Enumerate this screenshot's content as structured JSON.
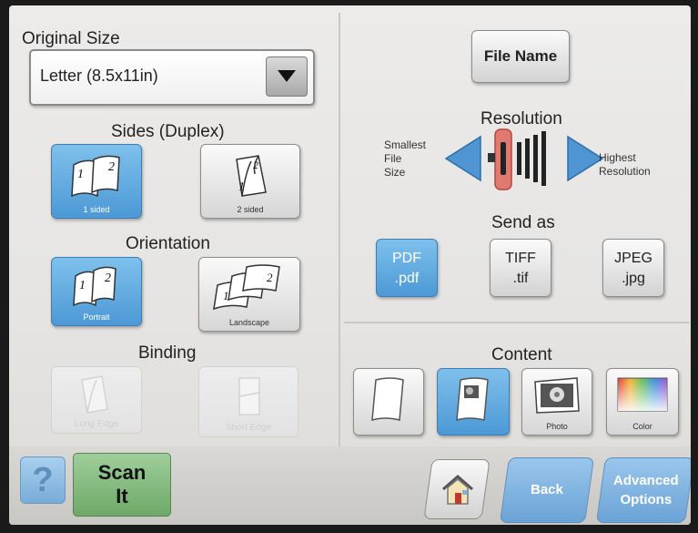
{
  "original_size": {
    "title": "Original Size",
    "selected": "Letter (8.5x11in)"
  },
  "sides": {
    "title": "Sides (Duplex)",
    "options": [
      {
        "label": "1 sided",
        "selected": true
      },
      {
        "label": "2 sided",
        "selected": false
      }
    ]
  },
  "orientation": {
    "title": "Orientation",
    "options": [
      {
        "label": "Portrait",
        "selected": true
      },
      {
        "label": "Landscape",
        "selected": false
      }
    ]
  },
  "binding": {
    "title": "Binding",
    "options": [
      {
        "label": "Long Edge",
        "enabled": false
      },
      {
        "label": "Short Edge",
        "enabled": false
      }
    ]
  },
  "file_name_button": "File Name",
  "resolution": {
    "title": "Resolution",
    "left_label": [
      "Smallest",
      "File",
      "Size"
    ],
    "right_label": [
      "Highest",
      "Resolution"
    ]
  },
  "send_as": {
    "title": "Send as",
    "formats": [
      {
        "name": "PDF",
        "ext": ".pdf",
        "selected": true
      },
      {
        "name": "TIFF",
        "ext": ".tif",
        "selected": false
      },
      {
        "name": "JPEG",
        "ext": ".jpg",
        "selected": false
      }
    ]
  },
  "content": {
    "title": "Content",
    "options": [
      {
        "label": "",
        "icon": "blank-page-icon",
        "selected": false
      },
      {
        "label": "",
        "icon": "text-photo-page-icon",
        "selected": true
      },
      {
        "label": "Photo",
        "icon": "photo-icon",
        "selected": false
      },
      {
        "label": "Color",
        "icon": "color-spectrum-icon",
        "selected": false
      }
    ]
  },
  "bottom": {
    "help": "?",
    "scan": [
      "Scan",
      "It"
    ],
    "back": "Back",
    "advanced": [
      "Advanced",
      "Options"
    ]
  },
  "colors": {
    "selected_blue": "#4c99d6",
    "scan_green": "#6ea868",
    "slider_red": "#d9534f",
    "arrow_blue": "#4f95d3"
  }
}
